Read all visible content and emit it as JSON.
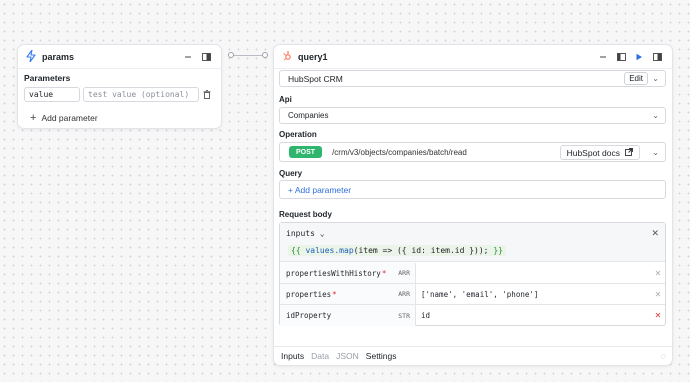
{
  "params_node": {
    "title": "params",
    "section_label": "Parameters",
    "param_name": "value",
    "param_value_placeholder": "test value (optional)",
    "add_parameter_label": "Add parameter"
  },
  "query_node": {
    "title": "query1",
    "integration": "HubSpot CRM",
    "edit_label": "Edit",
    "api_label": "Api",
    "api_value": "Companies",
    "operation_label": "Operation",
    "method": "POST",
    "operation_path": "/crm/v3/objects/companies/batch/read",
    "docs_label": "HubSpot docs",
    "query_label": "Query",
    "add_query_parameter": "+ Add parameter",
    "request_body_label": "Request body",
    "inputs_key": "inputs",
    "inputs_expression": {
      "open": "{{",
      "fn": "values.map",
      "body": "(item => ({ id: item.id }));",
      "close": "}}"
    },
    "body_fields": [
      {
        "key": "propertiesWithHistory",
        "required": "*",
        "type": "ARR",
        "value": ""
      },
      {
        "key": "properties",
        "required": "*",
        "type": "ARR",
        "value": "['name', 'email', 'phone']"
      },
      {
        "key": "idProperty",
        "required": "",
        "type": "STR",
        "value": "id"
      }
    ],
    "tabs": [
      "Inputs",
      "Data",
      "JSON",
      "Settings"
    ]
  },
  "colors": {
    "post_badge": "#2fb56d",
    "link_blue": "#2f6fde",
    "required_star": "#dd3333",
    "hubspot_orange": "#ff7a59",
    "params_icon_blue": "#3a7bf0"
  }
}
